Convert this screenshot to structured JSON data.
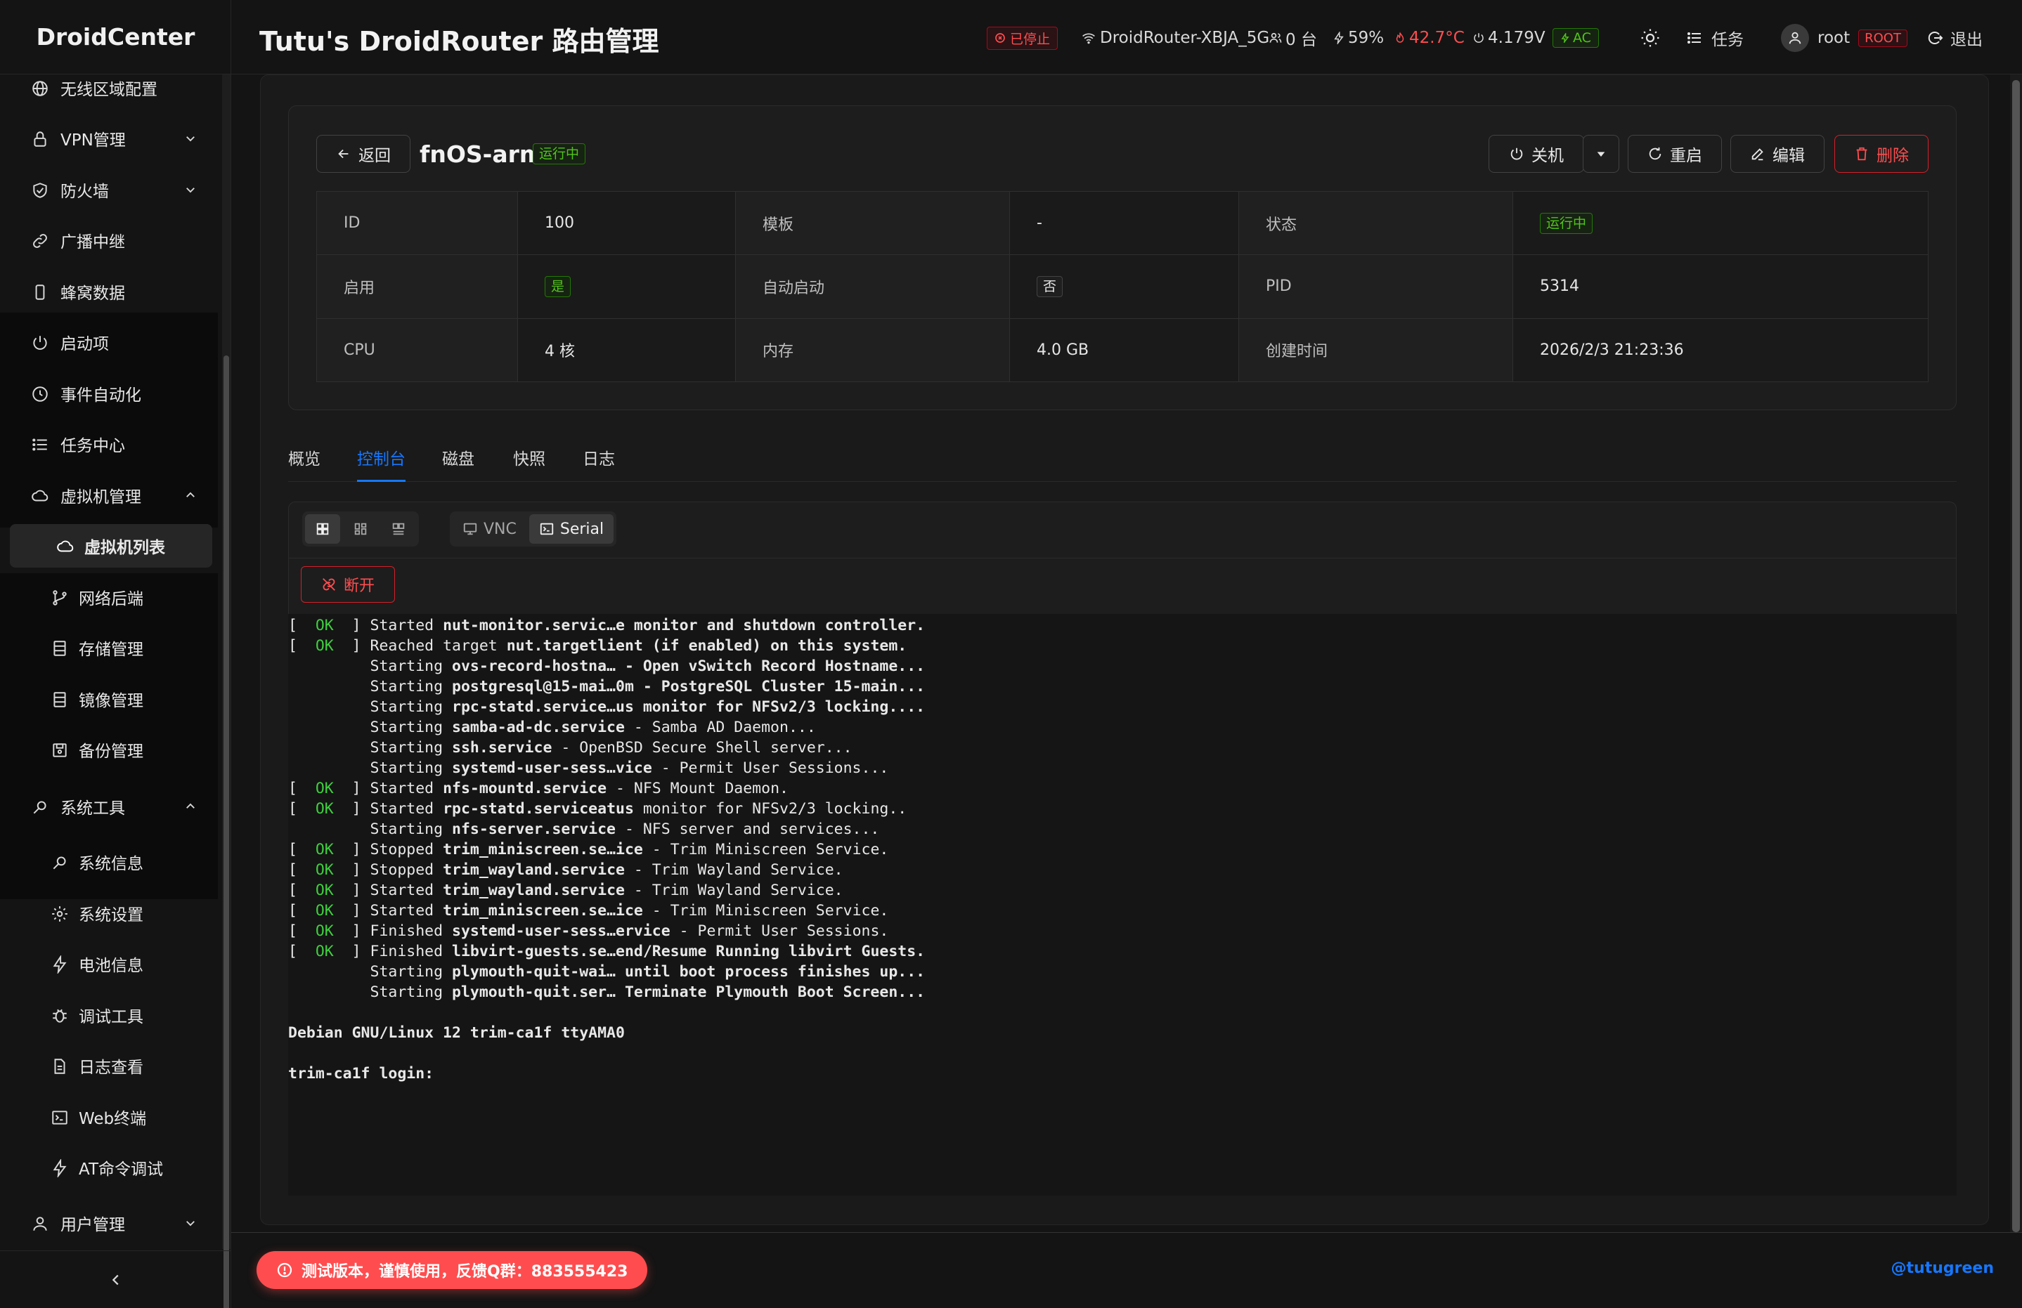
{
  "brand": "DroidCenter",
  "header": {
    "title": "Tutu's DroidRouter 路由管理",
    "status_stopped": "已停止",
    "wifi_ssid": "DroidRouter-XBJA_5G",
    "clients": "0 台",
    "battery": "59%",
    "temperature": "42.7°C",
    "voltage": "4.179V",
    "power": "AC",
    "tasks": "任务",
    "user": "root",
    "role": "ROOT",
    "logout": "退出",
    "colors": {
      "danger": "#ff4d4f",
      "success": "#52c41a",
      "primary": "#1677ff"
    }
  },
  "sidebar": {
    "items": [
      {
        "label": "无线区域配置",
        "icon": "globe-icon"
      },
      {
        "label": "VPN管理",
        "icon": "lock-icon"
      },
      {
        "label": "防火墙",
        "icon": "shield-icon"
      },
      {
        "label": "广播中继",
        "icon": "link-icon"
      },
      {
        "label": "蜂窝数据",
        "icon": "phone-icon"
      },
      {
        "label": "启动项",
        "icon": "power-icon"
      },
      {
        "label": "事件自动化",
        "icon": "clock-icon"
      },
      {
        "label": "任务中心",
        "icon": "list-icon"
      },
      {
        "label": "虚拟机管理",
        "icon": "cloud-icon"
      },
      {
        "label": "虚拟机列表",
        "icon": "cloud-icon"
      },
      {
        "label": "网络后端",
        "icon": "branch-icon"
      },
      {
        "label": "存储管理",
        "icon": "database-icon"
      },
      {
        "label": "镜像管理",
        "icon": "image-icon"
      },
      {
        "label": "备份管理",
        "icon": "save-icon"
      },
      {
        "label": "系统工具",
        "icon": "tool-icon"
      },
      {
        "label": "系统信息",
        "icon": "info-icon"
      },
      {
        "label": "系统设置",
        "icon": "gear-icon"
      },
      {
        "label": "电池信息",
        "icon": "bolt-icon"
      },
      {
        "label": "调试工具",
        "icon": "bug-icon"
      },
      {
        "label": "日志查看",
        "icon": "file-icon"
      },
      {
        "label": "Web终端",
        "icon": "terminal-icon"
      },
      {
        "label": "AT命令调试",
        "icon": "bolt-icon"
      },
      {
        "label": "用户管理",
        "icon": "user-icon"
      }
    ]
  },
  "vm": {
    "back": "返回",
    "name": "fnOS-arm",
    "status": "运行中",
    "actions": {
      "shutdown": "关机",
      "restart": "重启",
      "edit": "编辑",
      "delete": "删除"
    },
    "fields": {
      "id_label": "ID",
      "id": "100",
      "template_label": "模板",
      "template": "-",
      "state_label": "状态",
      "state": "运行中",
      "enabled_label": "启用",
      "enabled": "是",
      "autostart_label": "自动启动",
      "autostart": "否",
      "pid_label": "PID",
      "pid": "5314",
      "cpu_label": "CPU",
      "cpu": "4 核",
      "mem_label": "内存",
      "mem": "4.0 GB",
      "created_label": "创建时间",
      "created": "2026/2/3 21:23:36"
    }
  },
  "tabs": [
    "概览",
    "控制台",
    "磁盘",
    "快照",
    "日志"
  ],
  "console": {
    "mode_vnc": "VNC",
    "mode_serial": "Serial",
    "disconnect": "断开",
    "lines": [
      {
        "ok": true,
        "verb": "Started ",
        "unit": "nut-monitor.servic…e monitor and shutdown controller."
      },
      {
        "ok": true,
        "verb": "Reached target ",
        "unit": "nut.targetlient (if enabled) on this system."
      },
      {
        "ok": false,
        "verb": "Starting ",
        "unit": "ovs-record-hostna… - Open vSwitch Record Hostname..."
      },
      {
        "ok": false,
        "verb": "Starting ",
        "unit": "postgresql@15-mai…0m - PostgreSQL Cluster 15-main..."
      },
      {
        "ok": false,
        "verb": "Starting ",
        "unit": "rpc-statd.service…us monitor for NFSv2/3 locking...."
      },
      {
        "ok": false,
        "verb": "Starting ",
        "unit": "samba-ad-dc.service",
        "rest": " - Samba AD Daemon..."
      },
      {
        "ok": false,
        "verb": "Starting ",
        "unit": "ssh.service",
        "rest": " - OpenBSD Secure Shell server..."
      },
      {
        "ok": false,
        "verb": "Starting ",
        "unit": "systemd-user-sess…vice",
        "rest": " - Permit User Sessions..."
      },
      {
        "ok": true,
        "verb": "Started ",
        "unit": "nfs-mountd.service",
        "rest": " - NFS Mount Daemon."
      },
      {
        "ok": true,
        "verb": "Started ",
        "unit": "rpc-statd.serviceatus",
        "rest": " monitor for NFSv2/3 locking.."
      },
      {
        "ok": false,
        "verb": "Starting ",
        "unit": "nfs-server.service",
        "rest": " - NFS server and services..."
      },
      {
        "ok": true,
        "verb": "Stopped ",
        "unit": "trim_miniscreen.se…ice",
        "rest": " - Trim Miniscreen Service."
      },
      {
        "ok": true,
        "verb": "Stopped ",
        "unit": "trim_wayland.service",
        "rest": " - Trim Wayland Service."
      },
      {
        "ok": true,
        "verb": "Started ",
        "unit": "trim_wayland.service",
        "rest": " - Trim Wayland Service."
      },
      {
        "ok": true,
        "verb": "Started ",
        "unit": "trim_miniscreen.se…ice",
        "rest": " - Trim Miniscreen Service."
      },
      {
        "ok": true,
        "verb": "Finished ",
        "unit": "systemd-user-sess…ervice",
        "rest": " - Permit User Sessions."
      },
      {
        "ok": true,
        "verb": "Finished ",
        "unit": "libvirt-guests.se…end/Resume Running libvirt Guests."
      },
      {
        "ok": false,
        "verb": "Starting ",
        "unit": "plymouth-quit-wai… until boot process finishes up..."
      },
      {
        "ok": false,
        "verb": "Starting ",
        "unit": "plymouth-quit.ser… Terminate Plymouth Boot Screen..."
      }
    ],
    "banner": "Debian GNU/Linux 12 trim-ca1f ttyAMA0",
    "prompt": "trim-ca1f login:"
  },
  "footer": {
    "notice": "测试版本，谨慎使用，反馈Q群：883555423",
    "credit": "@tutugreen"
  }
}
